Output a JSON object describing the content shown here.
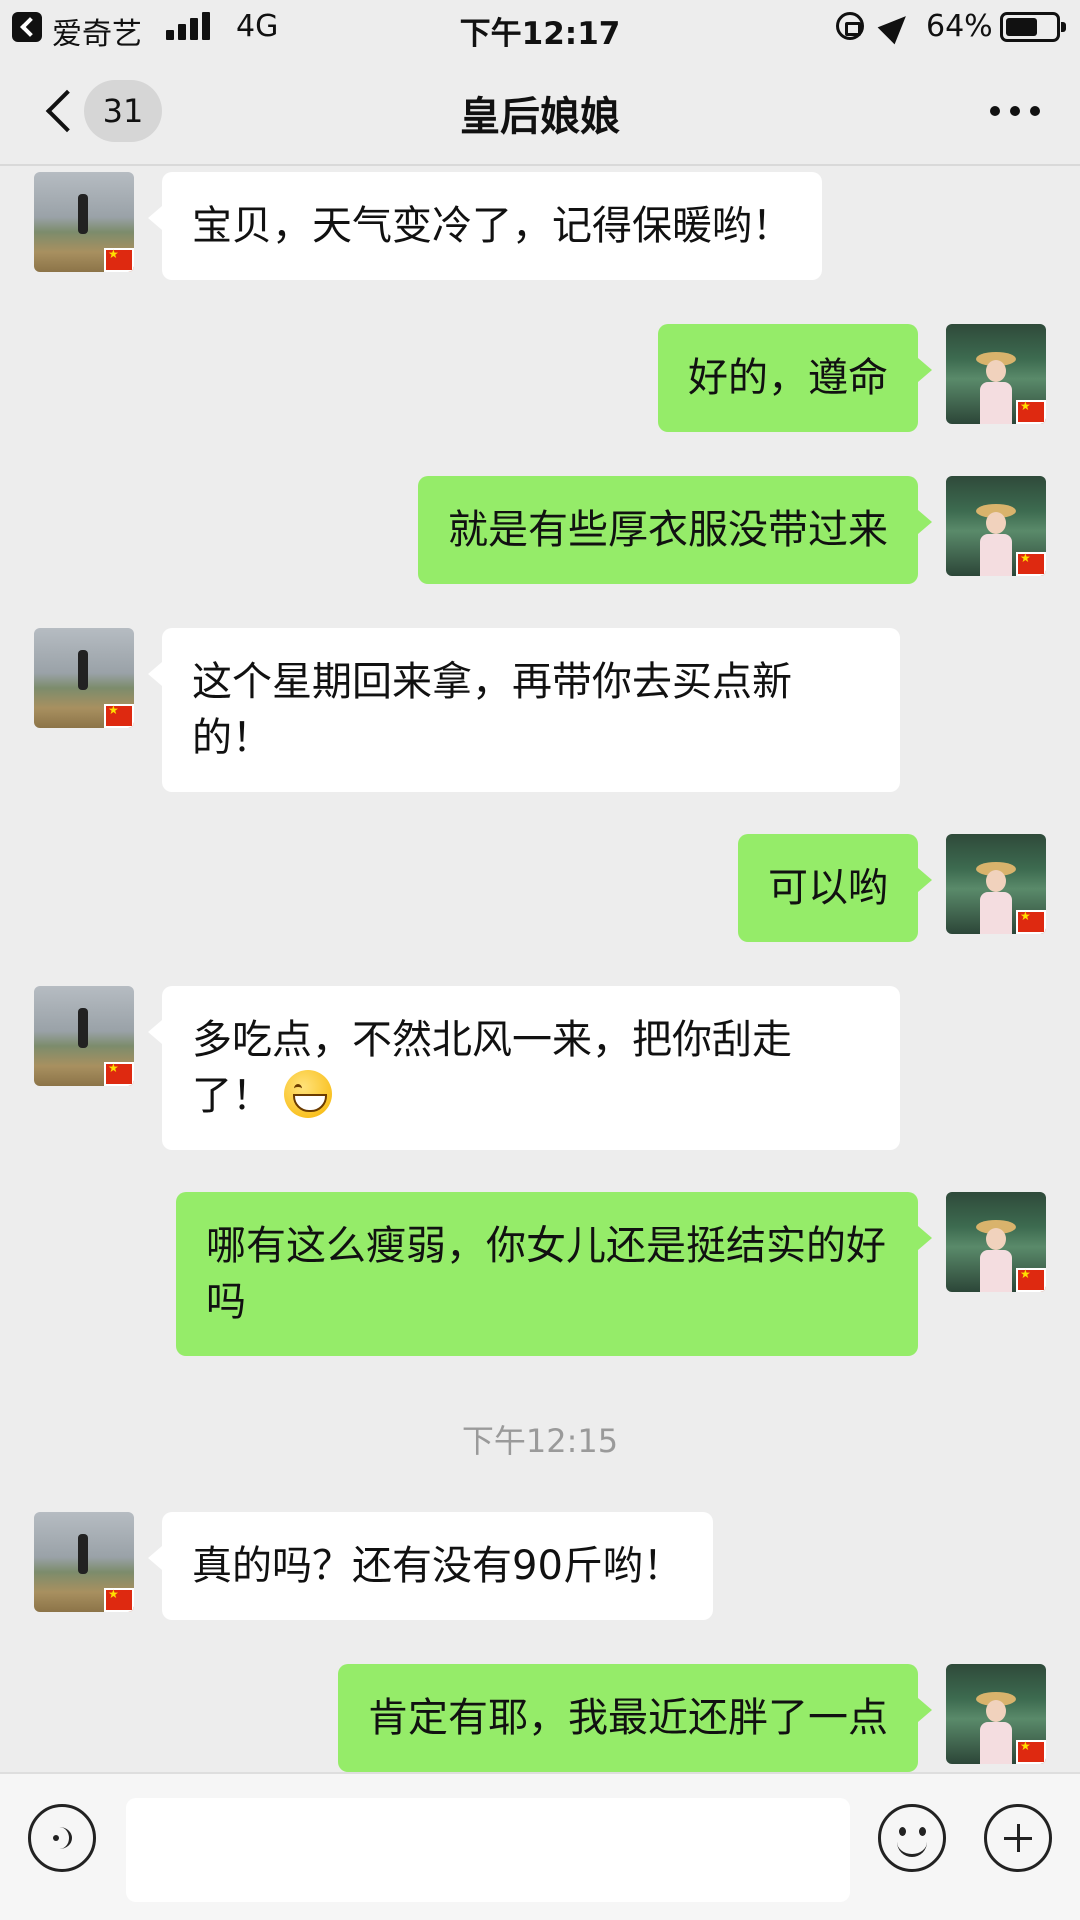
{
  "status_bar": {
    "back_app": "爱奇艺",
    "network": "4G",
    "time": "下午12:17",
    "battery": "64%",
    "battery_level": 0.64
  },
  "nav": {
    "unread_count": "31",
    "title": "皇后娘娘",
    "more_icon": "more-icon"
  },
  "messages": [
    {
      "side": "in",
      "text": "宝贝，天气变冷了，记得保暖哟！"
    },
    {
      "side": "out",
      "text": "好的，遵命"
    },
    {
      "side": "out",
      "text": "就是有些厚衣服没带过来"
    },
    {
      "side": "in",
      "text": "这个星期回来拿，再带你去买点新的！"
    },
    {
      "side": "out",
      "text": "可以哟"
    },
    {
      "side": "in",
      "text": "多吃点，不然北风一来，把你刮走了！",
      "emoji": "grin-emoji"
    },
    {
      "side": "out",
      "text": "哪有这么瘦弱，你女儿还是挺结实的好吗"
    },
    {
      "side": "in",
      "text": "真的吗？还有没有90斤哟！"
    },
    {
      "side": "out",
      "text": "肯定有耶，我最近还胖了一点"
    }
  ],
  "timestamp": "下午12:15",
  "input_bar": {
    "voice_icon": "voice-icon",
    "emoji_icon": "emoji-icon",
    "plus_icon": "plus-icon",
    "value": ""
  },
  "colors": {
    "background": "#ededed",
    "outgoing_bubble": "#95ec69",
    "incoming_bubble": "#ffffff"
  }
}
